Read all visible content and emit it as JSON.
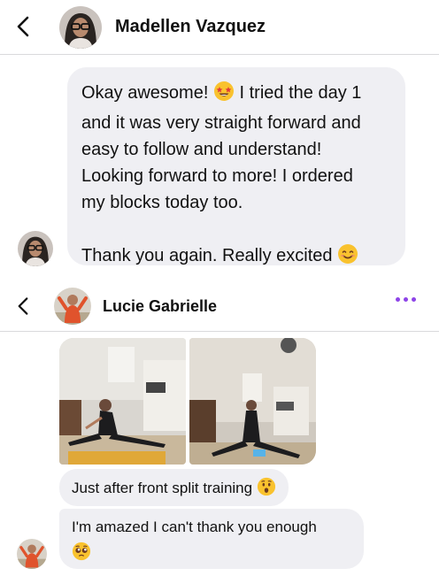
{
  "conversation1": {
    "contact_name": "Madellen Vazquez",
    "message": {
      "lines": [
        "Okay awesome! ",
        "I tried the day 1",
        "and it was very straight forward and",
        "easy to follow and understand!",
        "Looking forward to more! I ordered",
        "my blocks today too."
      ],
      "thanks": "Thank you again. Really excited "
    }
  },
  "conversation2": {
    "contact_name": "Lucie Gabrielle",
    "messages": [
      {
        "text": "Just after front split training "
      },
      {
        "text": "I'm amazed I can't thank you enough"
      }
    ]
  },
  "icons": {
    "back": "chevron-left-icon",
    "more": "more-dots-icon",
    "emoji_starstruck": "star-struck-emoji",
    "emoji_smile": "smiling-emoji",
    "emoji_hushed": "hushed-emoji",
    "emoji_pleading": "pleading-emoji"
  },
  "colors": {
    "bubble": "#efeff3",
    "accent": "#8e44e8"
  }
}
